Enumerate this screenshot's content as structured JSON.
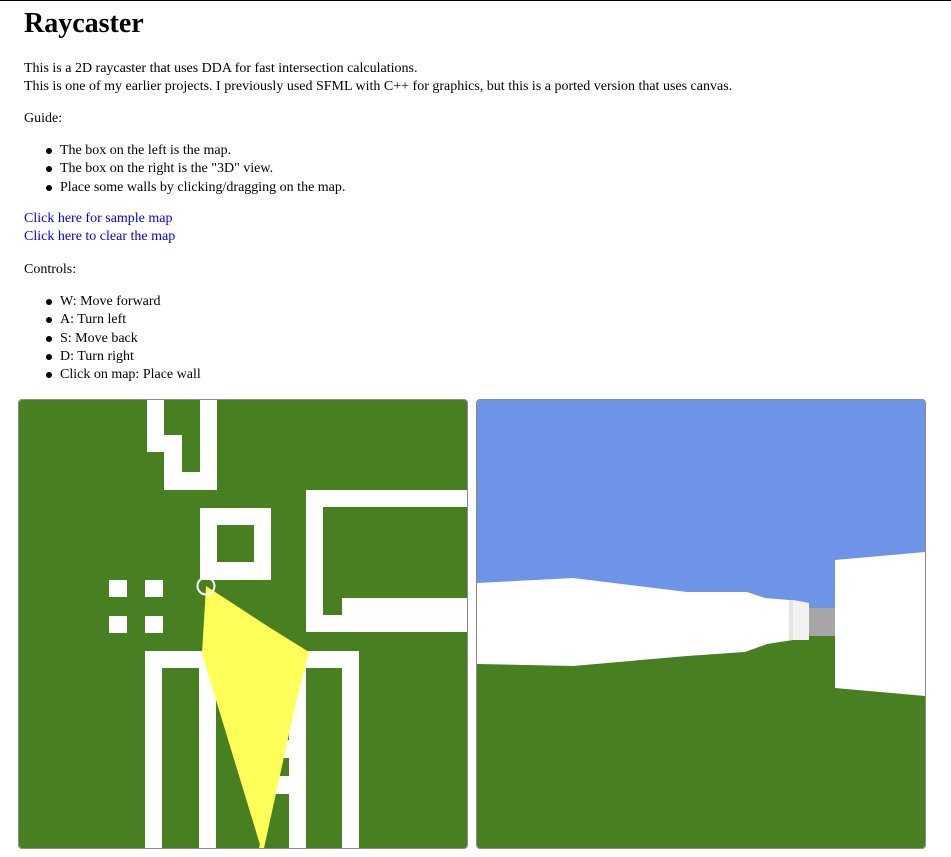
{
  "page": {
    "title": "Raycaster",
    "intro_line1": "This is a 2D raycaster that uses DDA for fast intersection calculations.",
    "intro_line2": "This is one of my earlier projects. I previously used SFML with C++ for graphics, but this is a ported version that uses canvas.",
    "guide_heading": "Guide:",
    "guide_items": [
      "The box on the left is the map.",
      "The box on the right is the \"3D\" view.",
      "Place some walls by clicking/dragging on the map."
    ],
    "links": {
      "sample_map": "Click here for sample map",
      "clear_map": "Click here to clear the map"
    },
    "controls_heading": "Controls:",
    "controls_items": [
      "W: Move forward",
      "A: Turn left",
      "S: Move back",
      "D: Turn right",
      "Click on map: Place wall"
    ]
  },
  "colors": {
    "ground": "#477f21",
    "sky": "#6d94e6",
    "wall": "#ffffff",
    "ray_cone": "#ffff5a",
    "far_wall_gray": "#a6a6a6",
    "link": "#0000ee"
  }
}
